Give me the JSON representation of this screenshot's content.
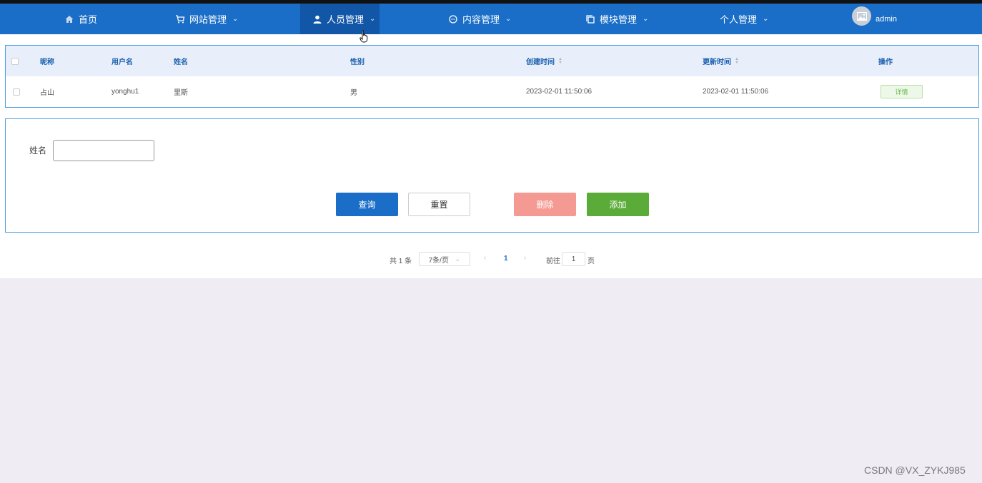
{
  "nav": {
    "home": "首页",
    "website": "网站管理",
    "personnel": "人员管理",
    "content": "内容管理",
    "module": "模块管理",
    "personal": "个人管理",
    "user": "admin"
  },
  "table": {
    "headers": [
      "昵称",
      "用户名",
      "姓名",
      "性别",
      "创建时间",
      "更新时间",
      "操作"
    ],
    "rows": [
      {
        "nickname": "占山",
        "username": "yonghu1",
        "name": "里斯",
        "gender": "男",
        "created": "2023-02-01 11:50:06",
        "updated": "2023-02-01 11:50:06",
        "action": "详情"
      }
    ]
  },
  "form": {
    "name_label": "姓名",
    "name_value": "",
    "query": "查询",
    "reset": "重置",
    "delete": "删除",
    "add": "添加"
  },
  "pagination": {
    "total": "共 1 条",
    "page_size": "7条/页",
    "current": "1",
    "goto": "前往",
    "goto_value": "1",
    "page_suffix": "页"
  },
  "watermark": "CSDN @VX_ZYKJ985",
  "colors": {
    "nav": "#1a6ec7",
    "nav_active": "#1256a8",
    "query": "#1a6ec7",
    "delete": "#f59a93",
    "add": "#5aab37"
  }
}
